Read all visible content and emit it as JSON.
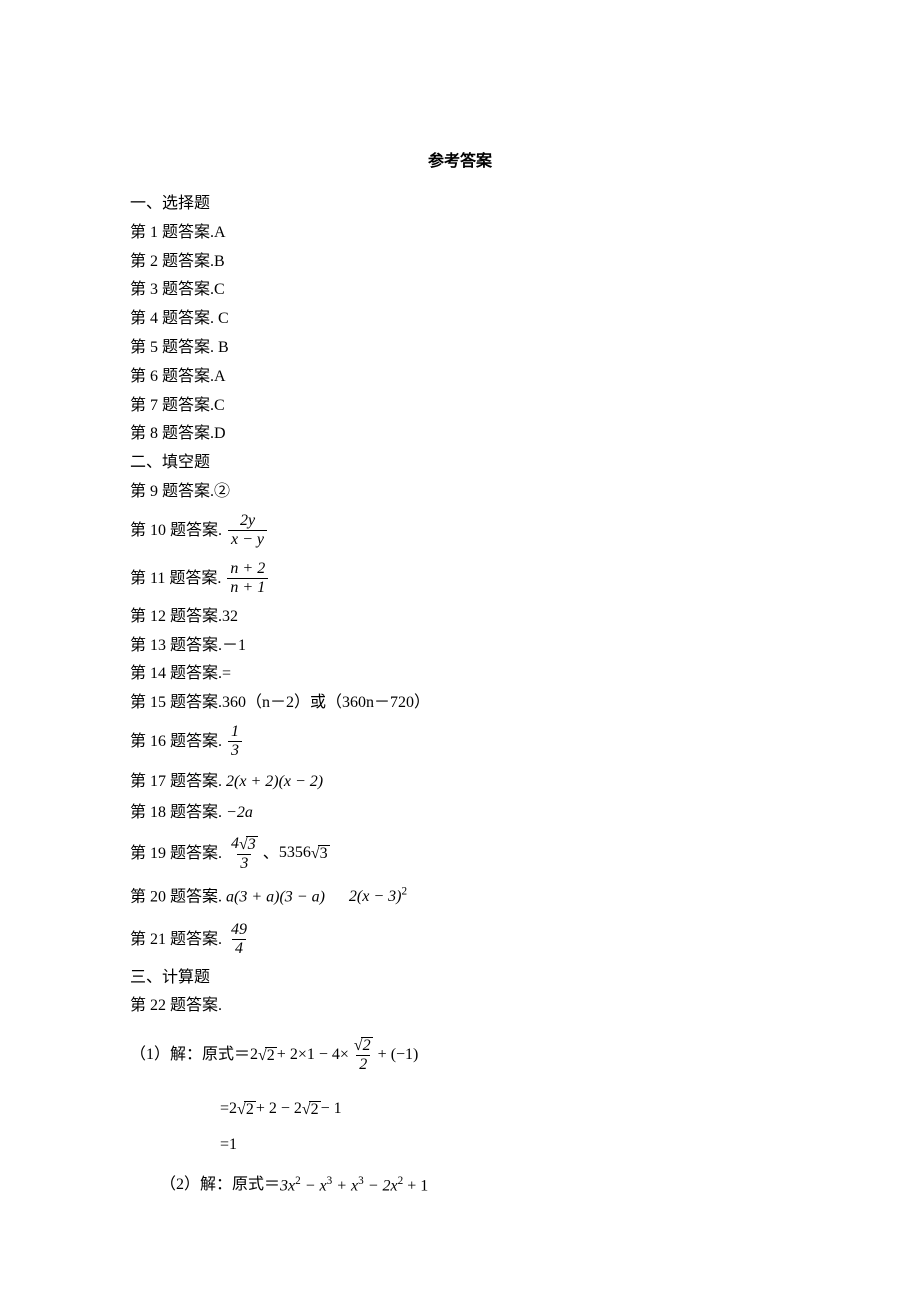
{
  "title": "参考答案",
  "section1_header": "一、选择题",
  "q1": {
    "label": "第 1 题答案.",
    "value": "A"
  },
  "q2": {
    "label": "第 2 题答案.",
    "value": "B"
  },
  "q3": {
    "label": "第 3 题答案.",
    "value": "C"
  },
  "q4": {
    "label": "第 4 题答案.",
    "value": " C"
  },
  "q5": {
    "label": "第 5 题答案.",
    "value": " B"
  },
  "q6": {
    "label": "第 6 题答案.",
    "value": "A"
  },
  "q7": {
    "label": "第 7 题答案.",
    "value": "C"
  },
  "q8": {
    "label": "第 8 题答案.",
    "value": "D"
  },
  "section2_header": "二、填空题",
  "q9": {
    "label": "第 9 题答案.",
    "value": "②"
  },
  "q10": {
    "label": "第 10 题答案.",
    "num": "2y",
    "den": "x − y"
  },
  "q11": {
    "label": "第 11 题答案.",
    "num": "n + 2",
    "den": "n + 1"
  },
  "q12": {
    "label": "第 12 题答案.",
    "value": "32"
  },
  "q13": {
    "label": "第 13 题答案.",
    "value": "－1"
  },
  "q14": {
    "label": "第 14 题答案.",
    "value": "="
  },
  "q15": {
    "label": "第 15 题答案.",
    "value": "360（n－2）或（360n－720）"
  },
  "q16": {
    "label": "第 16 题答案.",
    "num": "1",
    "den": "3"
  },
  "q17": {
    "label": "第 17 题答案.",
    "value": " 2(x + 2)(x − 2)"
  },
  "q18": {
    "label": "第 18 题答案.",
    "value": " −2a"
  },
  "q19": {
    "label": "第 19 题答案.",
    "num_a": "4",
    "sqrt_a": "3",
    "den_a": "3",
    "sep": "、",
    "coef_b": "5356",
    "sqrt_b": "3"
  },
  "q20": {
    "label": "第 20 题答案.",
    "part1_pre": " a(3 + a)(3 − a)",
    "gap": "    ",
    "part2_pre": "2(x − 3)",
    "part2_sup": "2"
  },
  "q21": {
    "label": "第 21 题答案.",
    "num": "49",
    "den": "4"
  },
  "section3_header": "三、计算题",
  "q22_label": "第 22 题答案.",
  "q22_1": {
    "prefix": "（1）解：原式＝",
    "t1_coef": "2",
    "t1_sqrt": "2",
    "t2": " + 2×1 − 4×",
    "t3_num_sqrt": "2",
    "t3_den": "2",
    "t4": " + (−1)"
  },
  "q22_1b": {
    "eq": "= ",
    "c1": "2",
    "s1": "2",
    "mid": " + 2 − 2",
    "s2": "2",
    "tail": " − 1"
  },
  "q22_1c": {
    "eq": "=",
    "val": "1"
  },
  "q22_2": {
    "prefix": "（2）解：原式＝",
    "expr_a": "3x",
    "sup_a": "2",
    "expr_b": " − x",
    "sup_b": "3",
    "expr_c": " + x",
    "sup_c": "3",
    "expr_d": " − 2x",
    "sup_d": "2",
    "expr_e": " + 1"
  }
}
